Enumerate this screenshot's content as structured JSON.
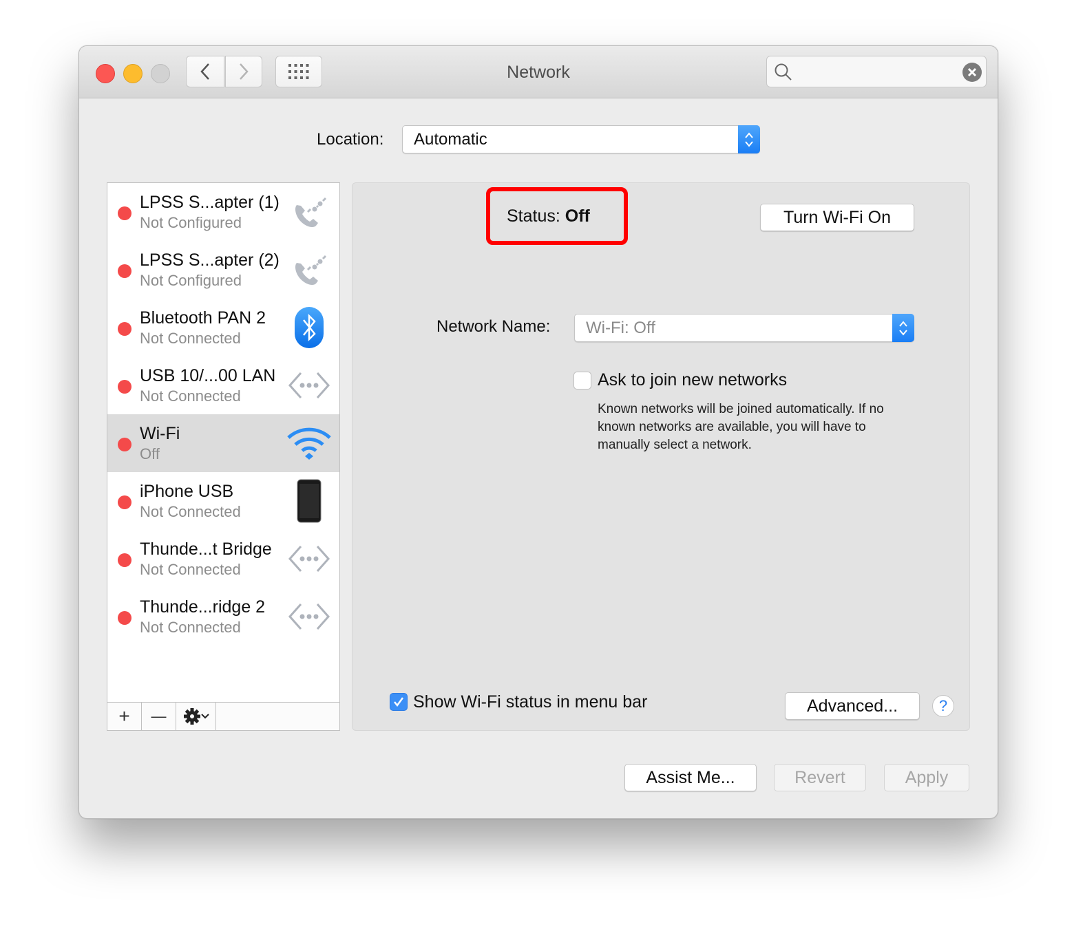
{
  "window": {
    "title": "Network",
    "search": {
      "value": "",
      "placeholder": ""
    }
  },
  "location": {
    "label": "Location:",
    "value": "Automatic"
  },
  "services": [
    {
      "name": "LPSS S...apter (1)",
      "status": "Not Configured",
      "icon": "phone-modem-icon",
      "status_color": "#f44a4a",
      "selected": false
    },
    {
      "name": "LPSS S...apter (2)",
      "status": "Not Configured",
      "icon": "phone-modem-icon",
      "status_color": "#f44a4a",
      "selected": false
    },
    {
      "name": "Bluetooth PAN 2",
      "status": "Not Connected",
      "icon": "bluetooth-icon",
      "status_color": "#f44a4a",
      "selected": false
    },
    {
      "name": "USB 10/...00 LAN",
      "status": "Not Connected",
      "icon": "ethernet-icon",
      "status_color": "#f44a4a",
      "selected": false
    },
    {
      "name": "Wi-Fi",
      "status": "Off",
      "icon": "wifi-icon",
      "status_color": "#f44a4a",
      "selected": true
    },
    {
      "name": "iPhone USB",
      "status": "Not Connected",
      "icon": "iphone-icon",
      "status_color": "#f44a4a",
      "selected": false
    },
    {
      "name": "Thunde...t Bridge",
      "status": "Not Connected",
      "icon": "ethernet-icon",
      "status_color": "#f44a4a",
      "selected": false
    },
    {
      "name": "Thunde...ridge 2",
      "status": "Not Connected",
      "icon": "ethernet-icon",
      "status_color": "#f44a4a",
      "selected": false
    }
  ],
  "sidebar_toolbar": {
    "add": "+",
    "remove": "—"
  },
  "detail": {
    "status_label": "Status:",
    "status_value": "Off",
    "turn_on_button": "Turn Wi-Fi On",
    "network_name_label": "Network Name:",
    "network_name_value": "Wi-Fi: Off",
    "ask_join_label": "Ask to join new networks",
    "ask_join_checked": false,
    "help_text": "Known networks will be joined automatically. If no known networks are available, you will have to manually select a network.",
    "show_status_label": "Show Wi-Fi status in menu bar",
    "show_status_checked": true,
    "advanced_button": "Advanced...",
    "help_button": "?"
  },
  "footer": {
    "assist_button": "Assist Me...",
    "revert_button": "Revert",
    "apply_button": "Apply"
  },
  "colors": {
    "accent": "#1a7ef5",
    "highlight": "#ff0000",
    "status_off": "#f44a4a"
  }
}
